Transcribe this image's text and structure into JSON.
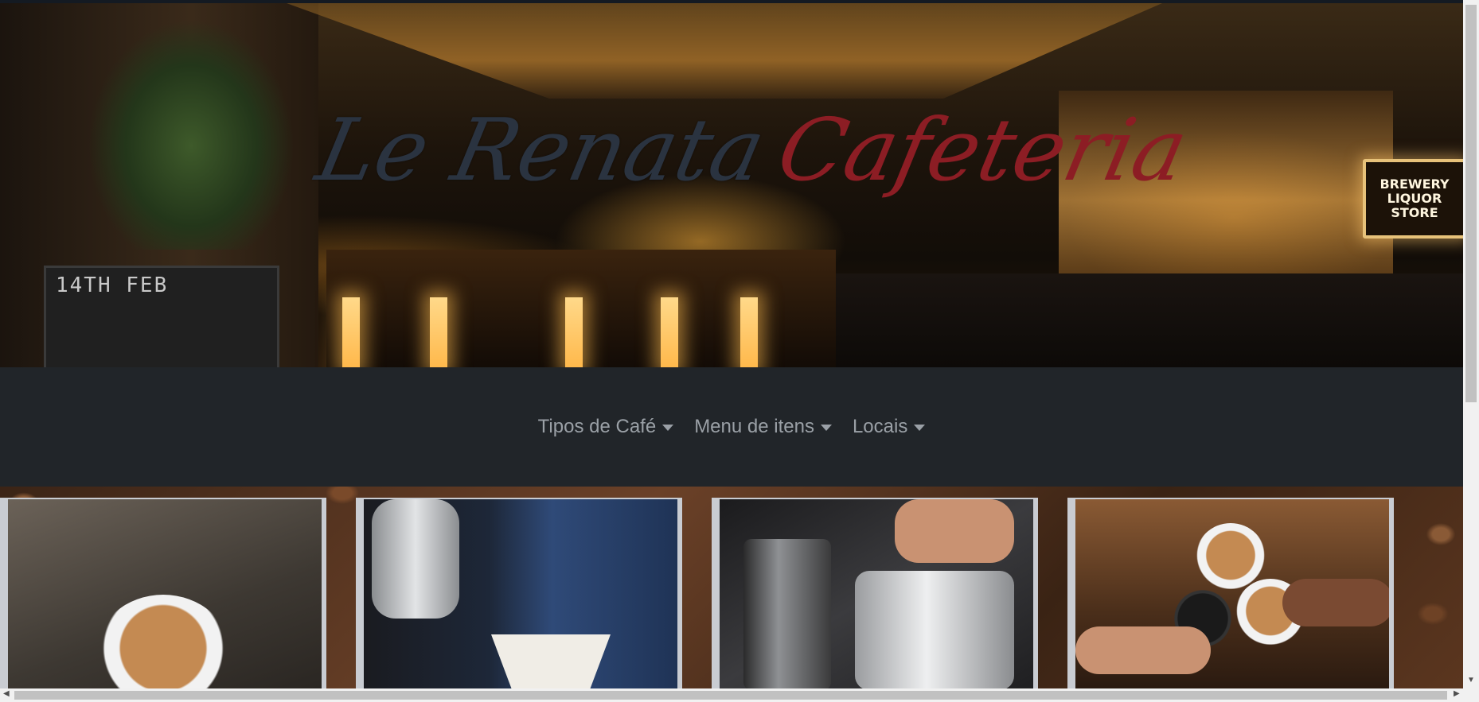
{
  "hero": {
    "brand_part1": "Le Renata",
    "brand_part2": "Cafeteria",
    "chalkboard_text": "14TH FEB",
    "sign_text": "BREWERY\nLIQUOR\nSTORE"
  },
  "nav": {
    "items": [
      {
        "label": "Tipos de Café",
        "icon": "caret-down-icon"
      },
      {
        "label": "Menu de itens",
        "icon": "caret-down-icon"
      },
      {
        "label": "Locais",
        "icon": "caret-down-icon"
      }
    ]
  },
  "cards": [
    {
      "subject": "espresso-cup-photo"
    },
    {
      "subject": "pour-over-kettle-photo"
    },
    {
      "subject": "milk-pitcher-photo"
    },
    {
      "subject": "latte-art-cups-photo"
    }
  ],
  "colors": {
    "navbar_bg": "#212529",
    "nav_text": "#9aa0a6",
    "brand_dark": "#2a3340",
    "brand_red": "#8c1d24"
  }
}
